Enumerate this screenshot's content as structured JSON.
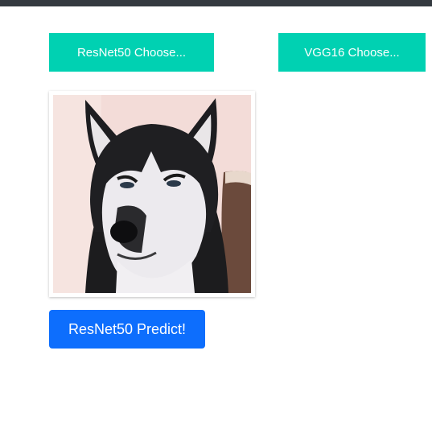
{
  "buttons": {
    "resnet_choose_label": "ResNet50 Choose...",
    "vgg_choose_label": "VGG16 Choose...",
    "predict_label": "ResNet50 Predict!"
  },
  "colors": {
    "top_bar": "#343a40",
    "choose_button": "#00d1b2",
    "predict_button": "#0d6efd"
  },
  "image": {
    "subject_icon": "husky-dog-photo"
  }
}
